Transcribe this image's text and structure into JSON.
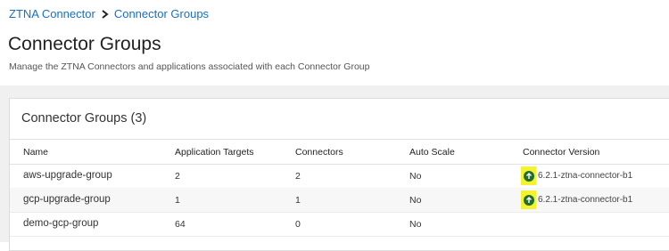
{
  "breadcrumb": {
    "root": "ZTNA Connector",
    "current": "Connector Groups"
  },
  "page": {
    "title": "Connector Groups",
    "subtitle": "Manage the ZTNA Connectors and applications associated with each Connector Group"
  },
  "card": {
    "title": "Connector Groups (3)"
  },
  "table": {
    "columns": [
      "Name",
      "Application Targets",
      "Connectors",
      "Auto Scale",
      "Connector Version"
    ],
    "rows": [
      {
        "name": "aws-upgrade-group",
        "application_targets": "2",
        "connectors": "2",
        "auto_scale": "No",
        "connector_version": "6.2.1-ztna-connector-b1",
        "upgrade_icon": "upgrade-arrow-icon"
      },
      {
        "name": "gcp-upgrade-group",
        "application_targets": "1",
        "connectors": "1",
        "auto_scale": "No",
        "connector_version": "6.2.1-ztna-connector-b1",
        "upgrade_icon": "upgrade-arrow-icon"
      },
      {
        "name": "demo-gcp-group",
        "application_targets": "64",
        "connectors": "0",
        "auto_scale": "No",
        "connector_version": "",
        "upgrade_icon": ""
      }
    ]
  },
  "colors": {
    "link": "#1a6fc0",
    "highlight": "#f3f330",
    "upgrade_icon": "#1f6e2e",
    "content_bg": "#f0f0f0"
  }
}
